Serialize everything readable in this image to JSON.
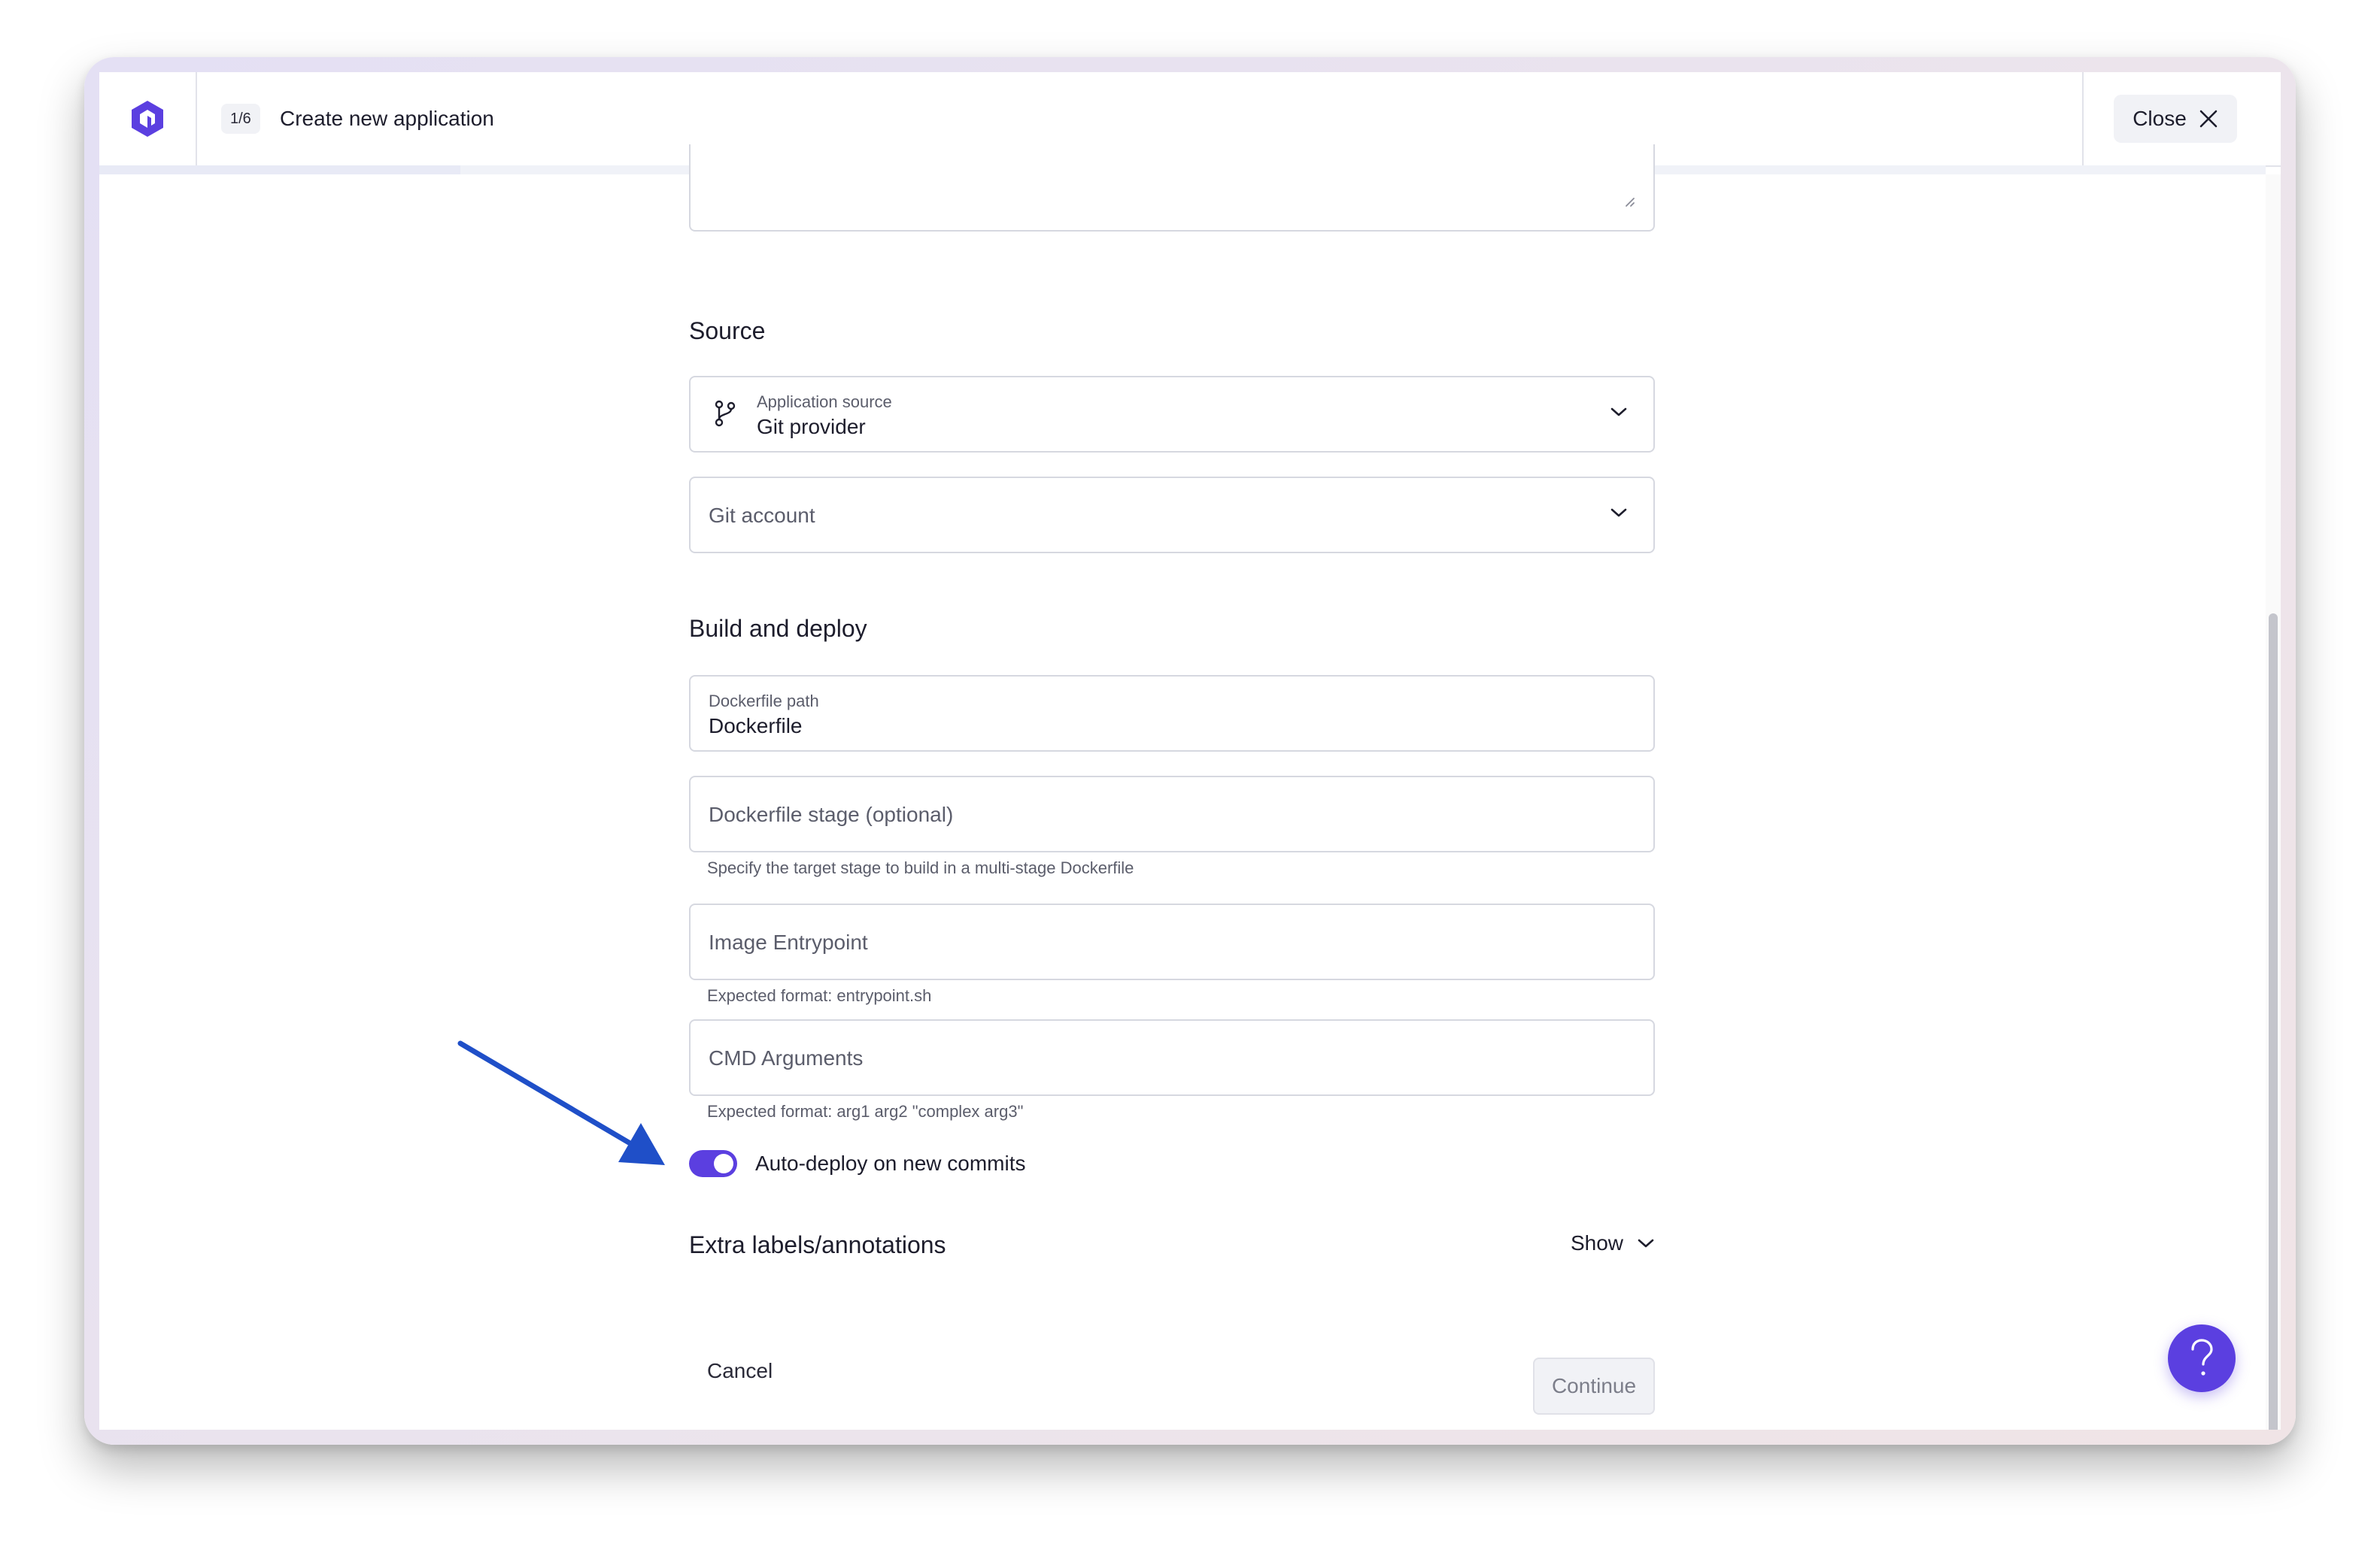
{
  "header": {
    "step_badge": "1/6",
    "title": "Create new application",
    "close_label": "Close",
    "progress_fraction": 0.1667
  },
  "source": {
    "section_title": "Source",
    "application_source": {
      "label": "Application source",
      "value": "Git provider"
    },
    "git_account": {
      "placeholder": "Git account"
    }
  },
  "build": {
    "section_title": "Build and deploy",
    "dockerfile_path": {
      "label": "Dockerfile path",
      "value": "Dockerfile"
    },
    "dockerfile_stage": {
      "placeholder": "Dockerfile stage (optional)",
      "helper": "Specify the target stage to build in a multi-stage Dockerfile"
    },
    "image_entrypoint": {
      "placeholder": "Image Entrypoint",
      "helper": "Expected format: entrypoint.sh"
    },
    "cmd_arguments": {
      "placeholder": "CMD Arguments",
      "helper": "Expected format: arg1 arg2 \"complex arg3\""
    },
    "auto_deploy": {
      "label": "Auto-deploy on new commits",
      "enabled": true
    }
  },
  "extra": {
    "section_title": "Extra labels/annotations",
    "show_label": "Show"
  },
  "footer": {
    "cancel_label": "Cancel",
    "continue_label": "Continue"
  },
  "colors": {
    "accent": "#5b3fe0",
    "annotation_arrow": "#1f4fc8"
  },
  "icons": {
    "logo": "app-logo-icon",
    "close": "close-icon",
    "git_branch": "git-branch-icon",
    "chevron": "chevron-down-icon",
    "help": "help-question-icon"
  }
}
